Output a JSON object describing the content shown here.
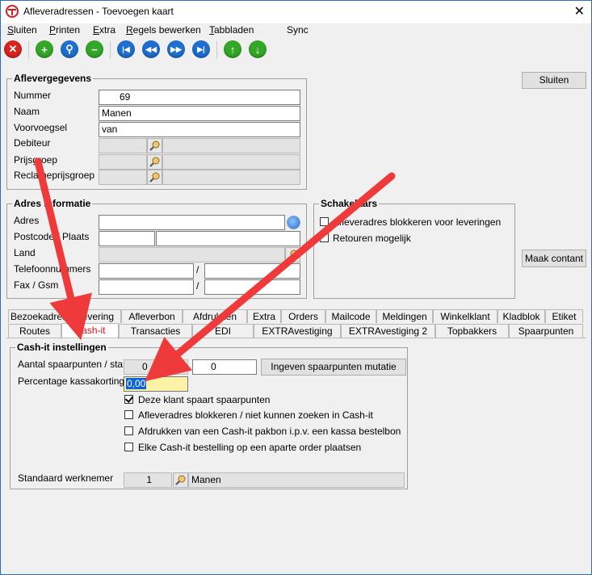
{
  "window": {
    "title": "Afleveradressen - Toevoegen kaart"
  },
  "menu": {
    "items": [
      "Sluiten",
      "Printen",
      "Extra",
      "Regels bewerken",
      "Tabbladen",
      "Sync"
    ],
    "underlines": [
      "S",
      "P",
      "E",
      "R",
      "T",
      ""
    ],
    "rests": [
      "luiten",
      "rinten",
      "xtra",
      "egels bewerken",
      "abbladen",
      "Sync"
    ]
  },
  "toolbar": {
    "icons": [
      "close-red-icon",
      "add-icon",
      "search-icon",
      "remove-icon",
      "first-icon",
      "prev-icon",
      "next-icon",
      "last-icon",
      "up-icon",
      "down-icon"
    ]
  },
  "buttons": {
    "sluiten": "Sluiten",
    "maak_contant": "Maak contant",
    "ingeven": "Ingeven spaarpunten mutatie"
  },
  "afleveregevens": {
    "legend": "Aflevergegevens",
    "nummer_label": "Nummer",
    "nummer_value": "69",
    "naam_label": "Naam",
    "naam_value": "Manen",
    "voorvoegsel_label": "Voorvoegsel",
    "voorvoegsel_value": "van",
    "debiteur_label": "Debiteur",
    "prijsgroep_label": "Prijsgroep",
    "reclameprijsgroep_label": "Reclameprijsgroep"
  },
  "adres": {
    "legend": "Adres informatie",
    "adres_label": "Adres",
    "postcode_label": "Postcode / Plaats",
    "land_label": "Land",
    "telefoon_label": "Telefoonnummers",
    "fax_label": "Fax / Gsm",
    "slash": "/"
  },
  "schakelaars": {
    "legend": "Schakelaars",
    "blokkeren": "Afleveradres blokkeren voor leveringen",
    "retouren": "Retouren mogelijk"
  },
  "tabs_row1": [
    "Bezoekadres",
    "Levering",
    "Afleverbon",
    "Afdrukken",
    "Extra",
    "Orders",
    "Mailcode",
    "Meldingen",
    "Winkelklant",
    "Kladblok",
    "Etiket"
  ],
  "tabs_row2": [
    "Routes",
    "Cash-it",
    "Transacties",
    "EDI",
    "EXTRAvestiging",
    "EXTRAvestiging 2",
    "Topbakkers",
    "Spaarpunten"
  ],
  "cashit": {
    "legend": "Cash-it instellingen",
    "aantal_label": "Aantal spaarpunten / start",
    "aantal_value": "0",
    "start_value": "0",
    "percentage_label": "Percentage kassakorting",
    "percentage_value": "0,00",
    "chk1": "Deze klant spaart spaarpunten",
    "chk2": "Afleveradres blokkeren / niet kunnen zoeken in Cash-it",
    "chk3": "Afdrukken van een Cash-it pakbon i.p.v. een kassa bestelbon",
    "chk4": "Elke Cash-it bestelling op een aparte order plaatsen",
    "werknemer_label": "Standaard werknemer",
    "werknemer_value": "1",
    "werknemer_name": "Manen"
  },
  "colors": {
    "accent_arrow": "#ee3a3a",
    "active_tab_text": "#dd1111",
    "highlight_field": "#fbf2a6"
  }
}
